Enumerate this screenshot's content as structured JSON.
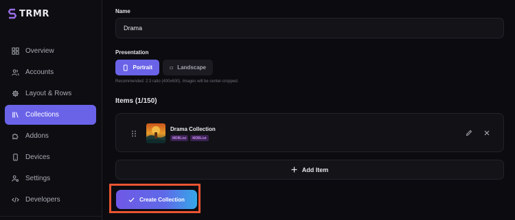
{
  "app": {
    "logo_text": "TRMR"
  },
  "sidebar": {
    "items": [
      {
        "label": "Overview",
        "icon": "grid-icon",
        "active": false
      },
      {
        "label": "Accounts",
        "icon": "users-icon",
        "active": false
      },
      {
        "label": "Layout & Rows",
        "icon": "gear-icon",
        "active": false
      },
      {
        "label": "Collections",
        "icon": "library-icon",
        "active": true
      },
      {
        "label": "Addons",
        "icon": "puzzle-icon",
        "active": false
      },
      {
        "label": "Devices",
        "icon": "smartphone-icon",
        "active": false
      },
      {
        "label": "Settings",
        "icon": "user-cog-icon",
        "active": false
      },
      {
        "label": "Developers",
        "icon": "code-icon",
        "active": false
      }
    ]
  },
  "form": {
    "name_label": "Name",
    "name_value": "Drama",
    "presentation_label": "Presentation",
    "portrait_label": "Portrait",
    "landscape_label": "Landscape",
    "selected_presentation": "Portrait",
    "hint": "Recommended: 2:3 ratio (400x600). Images will be center-cropped."
  },
  "items": {
    "title": "Items (1/150)",
    "list": [
      {
        "name": "Drama Collection",
        "tags": [
          "MDBList",
          "MDBList"
        ]
      }
    ],
    "add_label": "Add Item"
  },
  "actions": {
    "create_label": "Create Collection"
  },
  "colors": {
    "accent": "#6a63e8",
    "highlight": "#ea5532",
    "tag_bg": "#3a2150",
    "tag_text": "#c48cf0"
  }
}
